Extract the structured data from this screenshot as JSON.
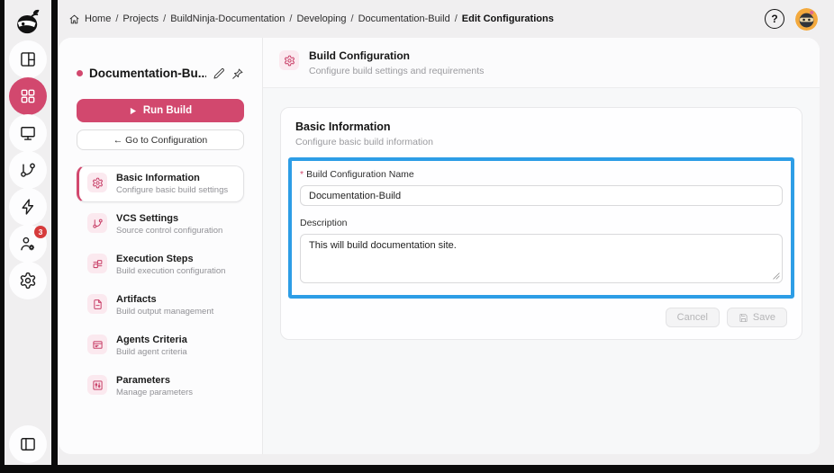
{
  "topbar": {
    "breadcrumb": [
      "Home",
      "Projects",
      "BuildNinja-Documentation",
      "Developing",
      "Documentation-Build",
      "Edit Configurations"
    ],
    "separator": "/",
    "help_glyph": "?"
  },
  "rail": {
    "badge_count": "3"
  },
  "left_panel": {
    "title": "Documentation-Bu...",
    "run_build_label": "Run Build",
    "goto_config_label": "← Go to Configuration",
    "menu": [
      {
        "label": "Basic Information",
        "sub": "Configure basic build settings"
      },
      {
        "label": "VCS Settings",
        "sub": "Source control configuration"
      },
      {
        "label": "Execution Steps",
        "sub": "Build execution configuration"
      },
      {
        "label": "Artifacts",
        "sub": "Build output management"
      },
      {
        "label": "Agents Criteria",
        "sub": "Build agent criteria"
      },
      {
        "label": "Parameters",
        "sub": "Manage parameters"
      }
    ]
  },
  "main": {
    "header": {
      "title": "Build Configuration",
      "subtitle": "Configure build settings and requirements"
    },
    "card": {
      "title": "Basic Information",
      "subtitle": "Configure basic build information",
      "name_field": {
        "required_marker": "*",
        "label": "Build Configuration Name",
        "value": "Documentation-Build"
      },
      "description_field": {
        "label": "Description",
        "value": "This will build documentation site."
      },
      "cancel_label": "Cancel",
      "save_label": "Save"
    }
  },
  "colors": {
    "accent": "#d2486e",
    "accent_soft": "#fbe9ef",
    "highlight_blue": "#2d9de6",
    "badge_red": "#d63b3b",
    "avatar_yellow": "#f3a93d"
  }
}
